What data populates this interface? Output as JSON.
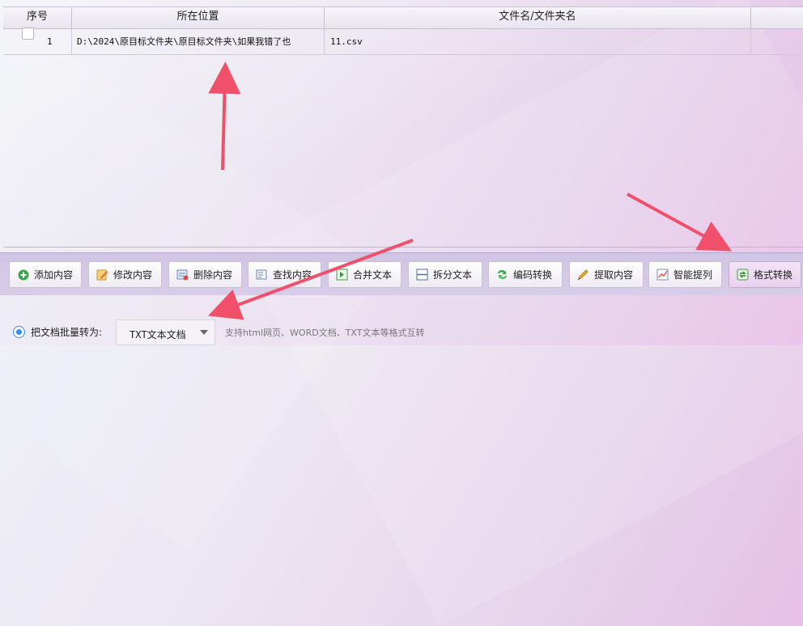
{
  "table": {
    "headers": {
      "index": "序号",
      "location": "所在位置",
      "filename": "文件名/文件夹名"
    },
    "rows": [
      {
        "index": "1",
        "location": "D:\\2024\\原目标文件夹\\原目标文件夹\\如果我错了也",
        "filename": "11.csv"
      }
    ]
  },
  "toolbar": {
    "buttons": [
      {
        "label": "添加内容",
        "icon": "plus-circle-icon"
      },
      {
        "label": "修改内容",
        "icon": "edit-icon"
      },
      {
        "label": "删除内容",
        "icon": "delete-icon"
      },
      {
        "label": "查找内容",
        "icon": "find-icon"
      },
      {
        "label": "合并文本",
        "icon": "merge-icon"
      },
      {
        "label": "拆分文本",
        "icon": "split-icon"
      },
      {
        "label": "编码转换",
        "icon": "encoding-icon"
      },
      {
        "label": "提取内容",
        "icon": "extract-icon"
      },
      {
        "label": "智能提列",
        "icon": "chart-icon"
      },
      {
        "label": "格式转换",
        "icon": "convert-icon"
      }
    ]
  },
  "convert": {
    "radio_label": "把文档批量转为:",
    "selected_format": "TXT文本文档",
    "hint": "支持html网页、WORD文档、TXT文本等格式互转"
  },
  "colors": {
    "accent": "#2f8ef0",
    "arrow": "#f0506a"
  }
}
